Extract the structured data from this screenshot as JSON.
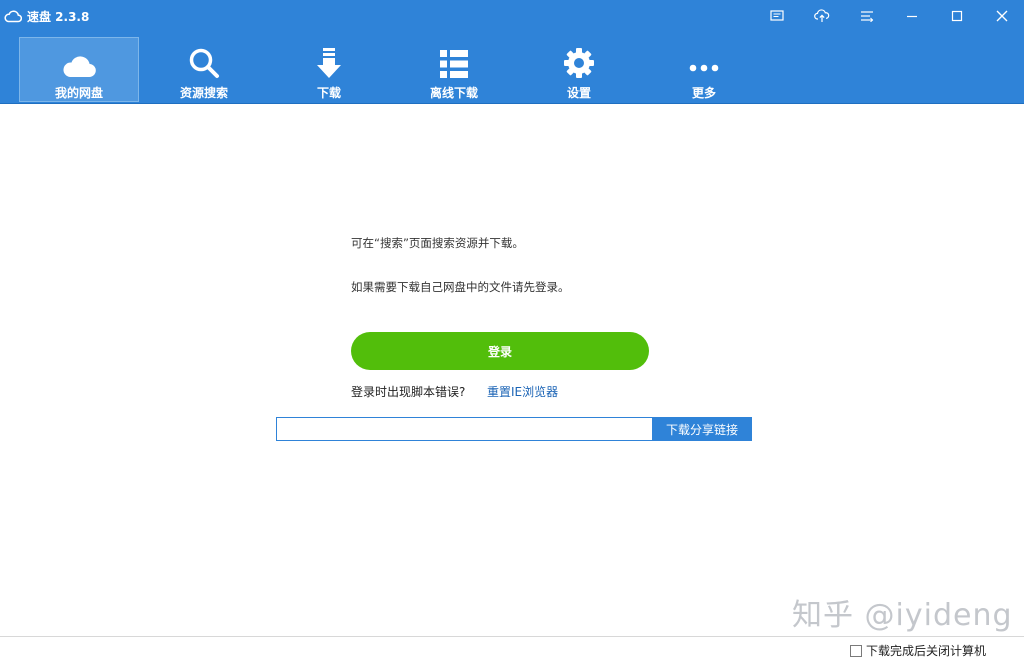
{
  "window": {
    "title": "速盘 2.3.8",
    "accent_color": "#2f83d8"
  },
  "toolbar": {
    "items": [
      {
        "label": "我的网盘",
        "icon": "cloud-icon",
        "active": true
      },
      {
        "label": "资源搜索",
        "icon": "search-icon",
        "active": false
      },
      {
        "label": "下载",
        "icon": "download-arrow-icon",
        "active": false
      },
      {
        "label": "离线下载",
        "icon": "list-icon",
        "active": false
      },
      {
        "label": "设置",
        "icon": "gear-icon",
        "active": false
      },
      {
        "label": "更多",
        "icon": "more-dots-icon",
        "active": false
      }
    ]
  },
  "main": {
    "hint_line1": "可在“搜索”页面搜索资源并下载。",
    "hint_line2": "如果需要下载自己网盘中的文件请先登录。",
    "login_label": "登录",
    "login_color": "#52be0b",
    "error_question": "登录时出现脚本错误?",
    "reset_link": "重置IE浏览器",
    "share_input_value": "",
    "share_button_label": "下载分享链接"
  },
  "watermark": "知乎 @iyideng",
  "status": {
    "shutdown_label": "下载完成后关闭计算机",
    "shutdown_checked": false
  }
}
